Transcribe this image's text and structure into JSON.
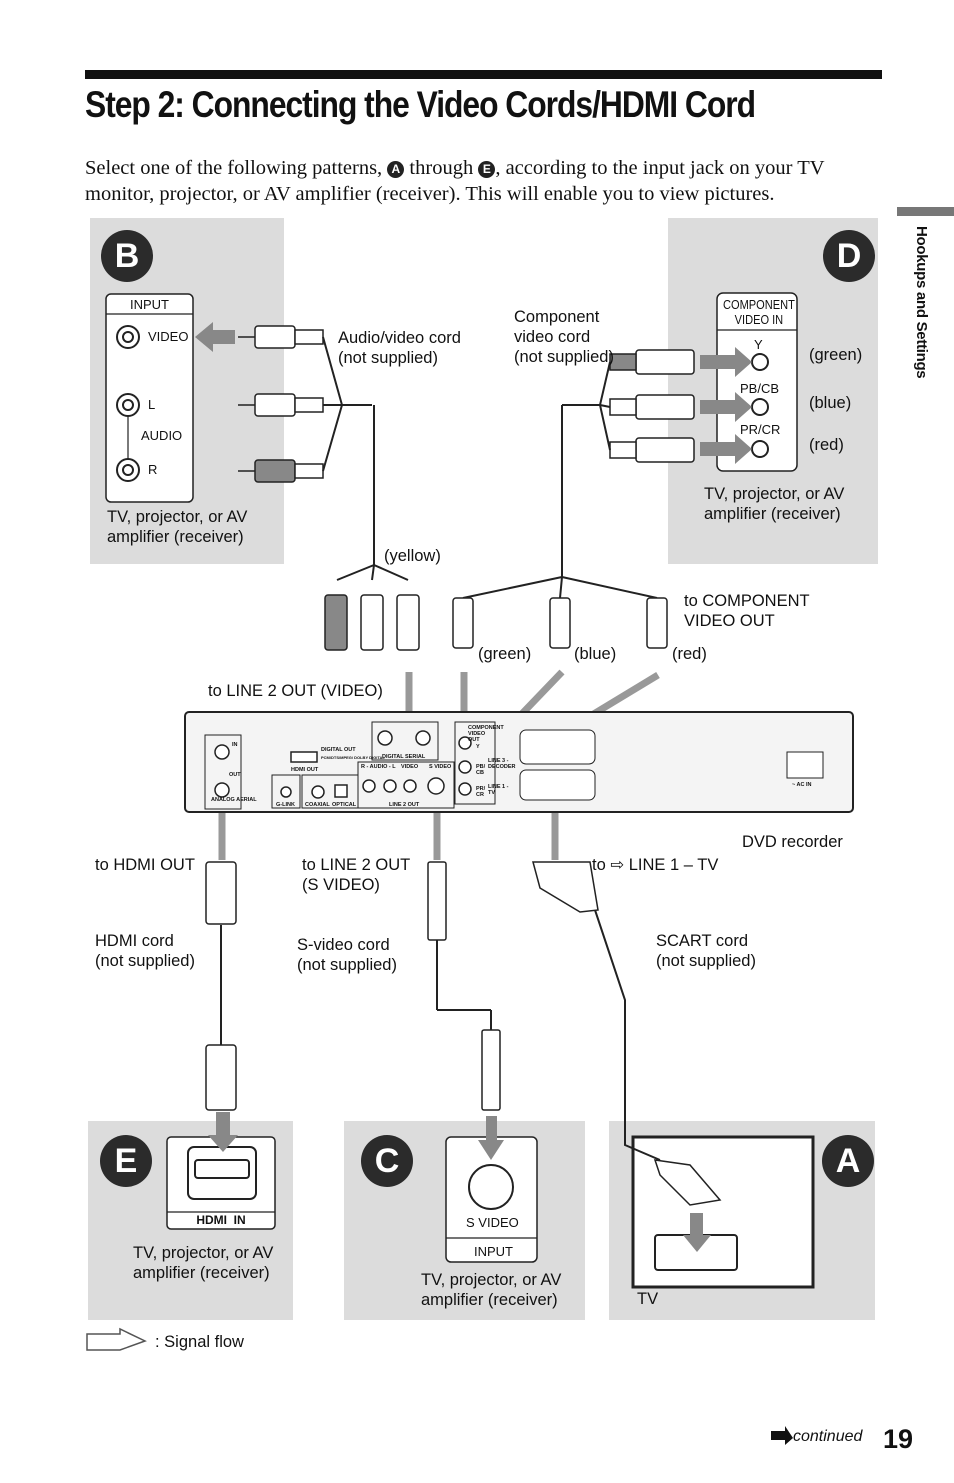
{
  "header": {
    "title": "Step 2: Connecting the Video Cords/HDMI Cord"
  },
  "intro": {
    "part1": "Select one of the following patterns, ",
    "badge_a": "A",
    "part2": " through ",
    "badge_e": "E",
    "part3": ", according to the input jack on your TV monitor, projector, or AV amplifier (receiver). This will enable you to view pictures."
  },
  "side_tab": {
    "label": "Hookups and Settings"
  },
  "diagram": {
    "panel_b": {
      "badge": "B",
      "input_label": "INPUT",
      "video": "VIDEO",
      "l": "L",
      "audio": "AUDIO",
      "r": "R",
      "device": "TV, projector, or AV\namplifier (receiver)"
    },
    "panel_d": {
      "badge": "D",
      "jack_header": "COMPONENT\nVIDEO IN",
      "y": "Y",
      "pb": "PB/CB",
      "pr": "PR/CR",
      "green": "(green)",
      "blue": "(blue)",
      "red": "(red)",
      "device": "TV, projector, or AV\namplifier (receiver)"
    },
    "panel_e": {
      "badge": "E",
      "jack": "HDMI  IN",
      "device": "TV, projector, or AV\namplifier (receiver)"
    },
    "panel_c": {
      "badge": "C",
      "jack": "S VIDEO",
      "input_label": "INPUT",
      "device": "TV, projector, or AV\namplifier (receiver)"
    },
    "panel_a": {
      "badge": "A",
      "device": "TV"
    },
    "labels": {
      "av_cord": "Audio/video cord\n(not supplied)",
      "component_cord": "Component\nvideo cord\n(not supplied)",
      "yellow": "(yellow)",
      "to_component": "to COMPONENT\nVIDEO OUT",
      "plug_green": "(green)",
      "plug_blue": "(blue)",
      "plug_red": "(red)",
      "to_line2_video": "to LINE 2 OUT (VIDEO)",
      "dvd_recorder": "DVD recorder",
      "to_hdmi_out": "to HDMI OUT",
      "to_line2_svideo": "to LINE 2 OUT\n(S VIDEO)",
      "to_line1_tv": "to ⇨ LINE 1 – TV",
      "hdmi_cord": "HDMI cord\n(not supplied)",
      "svideo_cord": "S-video cord\n(not supplied)",
      "scart_cord": "SCART cord\n(not supplied)"
    },
    "recorder_panel": {
      "analog_aerial": "ANALOG AERIAL",
      "in": "IN",
      "out": "OUT",
      "hdmi_out": "HDMI OUT",
      "digital_out": "DIGITAL OUT",
      "digital_out_sub": "PCM/DTS/MPEG/ DOLBY DIGITAL",
      "g_link": "G-LINK",
      "coaxial": "COAXIAL",
      "optical": "OPTICAL",
      "digital_serial": "DIGITAL SERIAL",
      "audio_rl": "R - AUDIO - L",
      "video": "VIDEO",
      "s_video": "S VIDEO",
      "line2_out": "LINE 2 OUT",
      "component_video_out": "COMPONENT VIDEO OUT",
      "y": "Y",
      "pb": "PB/ CB",
      "pr": "PR/ CR",
      "line3_decoder": "LINE 3 - DECODER",
      "line1_tv": "LINE 1 - TV",
      "ac_in": "~ AC IN"
    }
  },
  "legend": {
    "signal_flow": ": Signal flow"
  },
  "footer": {
    "continued": "continued",
    "page_number": "19"
  },
  "colors": {
    "panel": "#dcdcdc",
    "badge": "#2b2b2b",
    "arrow": "#888888"
  }
}
